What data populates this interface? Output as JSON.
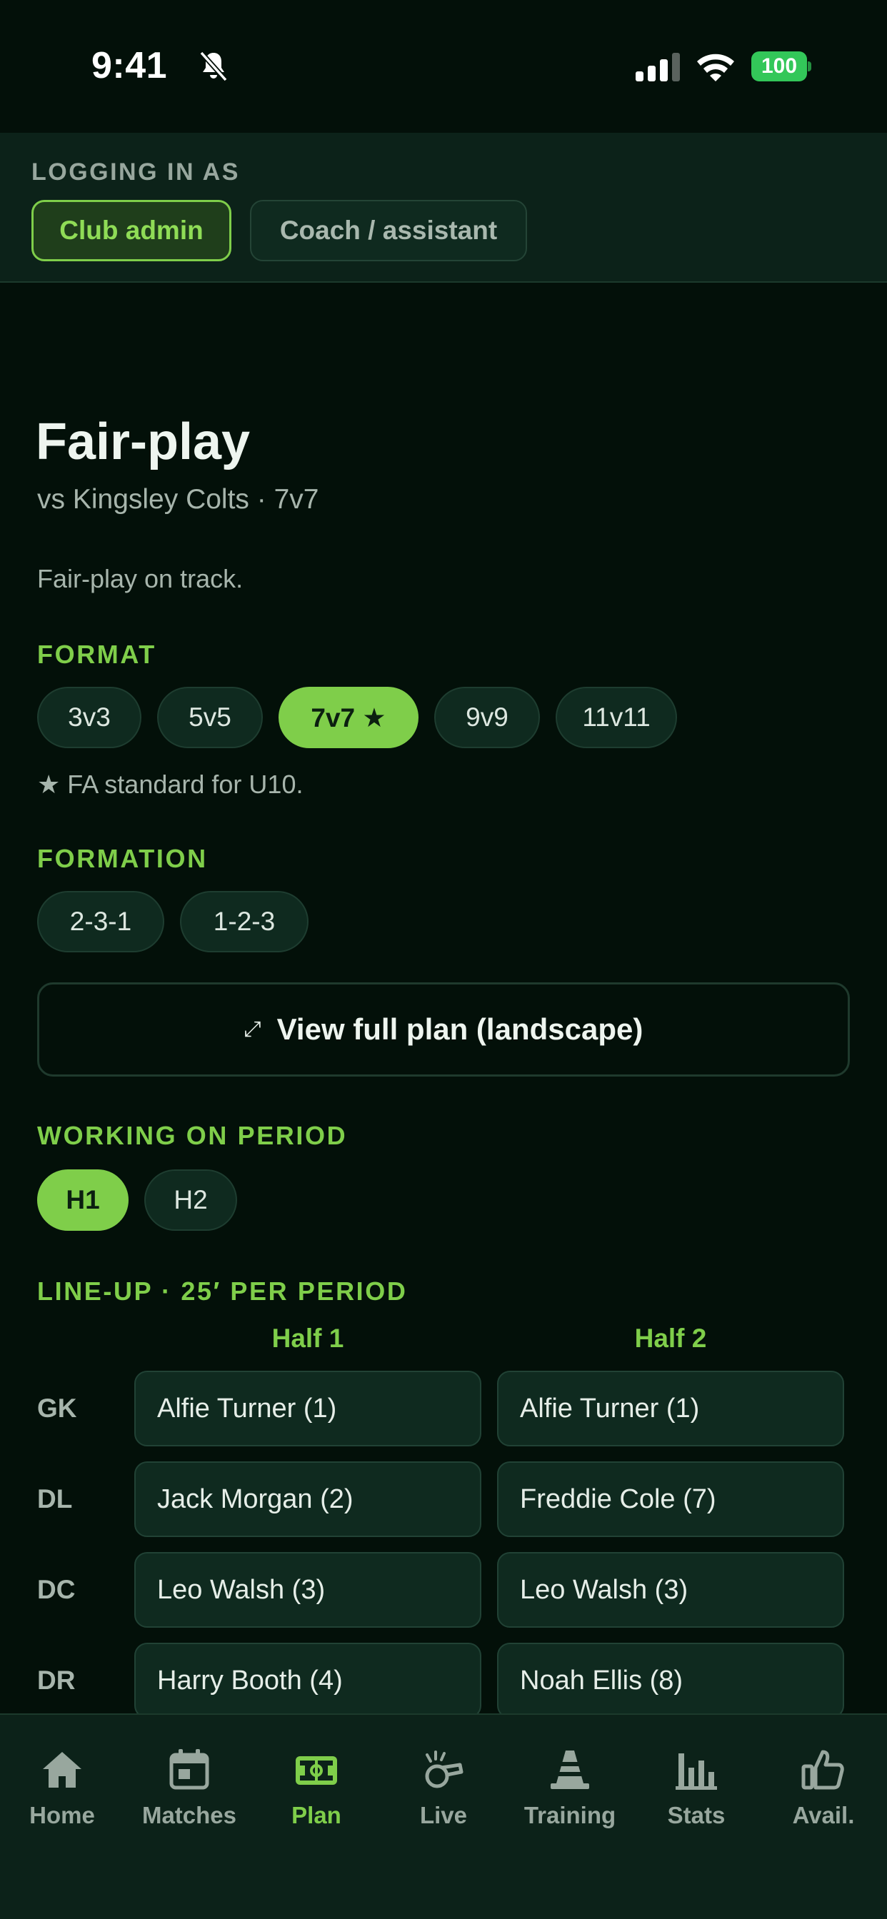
{
  "status_bar": {
    "time": "9:41",
    "battery": "100"
  },
  "role": {
    "label": "LOGGING IN AS",
    "options": [
      "Club admin",
      "Coach / assistant"
    ],
    "selected": "Club admin"
  },
  "header": {
    "title": "Fair-play",
    "subtitle": "vs Kingsley Colts · 7v7",
    "status": "Fair-play on track."
  },
  "format": {
    "label": "FORMAT",
    "options": [
      "3v3",
      "5v5",
      "7v7 ★",
      "9v9",
      "11v11"
    ],
    "selected": "7v7 ★",
    "note": "★ FA standard for U10."
  },
  "formation": {
    "label": "FORMATION",
    "options": [
      "2-3-1",
      "1-2-3"
    ]
  },
  "plan_button": {
    "icon": "⤢",
    "label": "View full plan (landscape)"
  },
  "period": {
    "label": "WORKING ON PERIOD",
    "options": [
      "H1",
      "H2"
    ],
    "selected": "H1"
  },
  "lineup": {
    "label": "LINE-UP · 25′ PER PERIOD",
    "columns": [
      "Half 1",
      "Half 2"
    ],
    "rows": [
      {
        "pos": "GK",
        "h1": "Alfie Turner (1)",
        "h2": "Alfie Turner (1)"
      },
      {
        "pos": "DL",
        "h1": "Jack Morgan (2)",
        "h2": "Freddie Cole (7)"
      },
      {
        "pos": "DC",
        "h1": "Leo Walsh (3)",
        "h2": "Leo Walsh (3)"
      },
      {
        "pos": "DR",
        "h1": "Harry Booth (4)",
        "h2": "Noah Ellis (8)"
      }
    ]
  },
  "nav": {
    "items": [
      {
        "label": "Home",
        "icon": "home-icon"
      },
      {
        "label": "Matches",
        "icon": "calendar-icon"
      },
      {
        "label": "Plan",
        "icon": "pitch-icon"
      },
      {
        "label": "Live",
        "icon": "whistle-icon"
      },
      {
        "label": "Training",
        "icon": "cone-icon"
      },
      {
        "label": "Stats",
        "icon": "bar-chart-icon"
      },
      {
        "label": "Avail.",
        "icon": "thumbs-up-icon"
      }
    ],
    "active": "Plan"
  },
  "colors": {
    "accent": "#7fce4a",
    "background": "#031009",
    "surface": "#0f2a1f",
    "battery": "#33c759"
  }
}
